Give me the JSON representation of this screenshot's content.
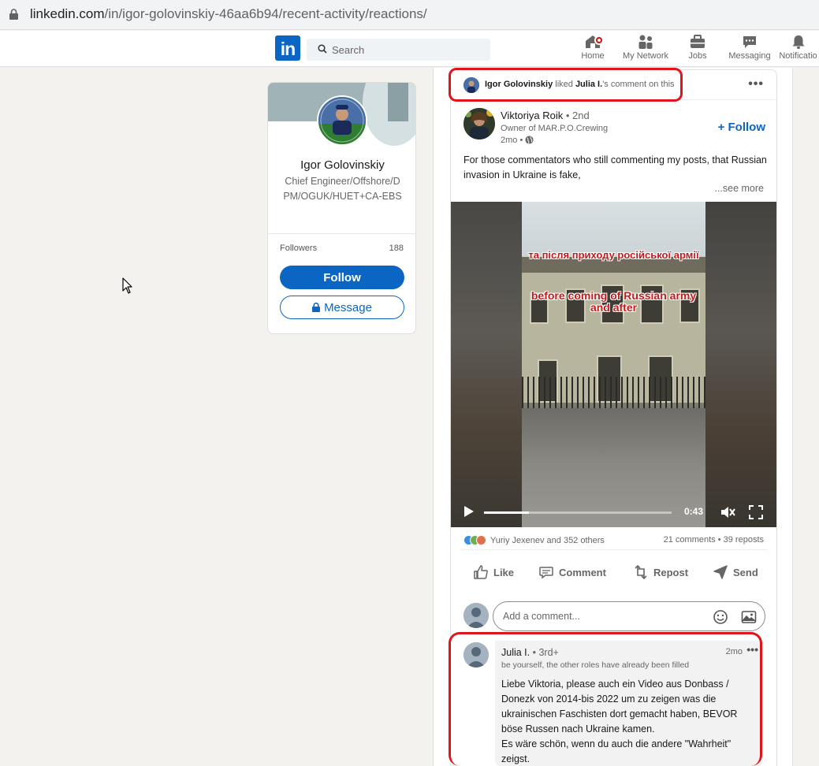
{
  "browser": {
    "url_domain": "linkedin.com",
    "url_path": "/in/igor-golovinskiy-46aa6b94/recent-activity/reactions/"
  },
  "nav": {
    "logo": "in",
    "search_placeholder": "Search",
    "items": [
      {
        "label": "Home",
        "icon": "home-icon"
      },
      {
        "label": "My Network",
        "icon": "network-icon"
      },
      {
        "label": "Jobs",
        "icon": "briefcase-icon"
      },
      {
        "label": "Messaging",
        "icon": "messaging-icon"
      },
      {
        "label": "Notificatio",
        "icon": "bell-icon"
      }
    ],
    "accent": "#0a66c2",
    "notification_color": "#cc1016"
  },
  "profile": {
    "name": "Igor Golovinskiy",
    "headline": "Chief Engineer/Offshore/DPM/OGUK/HUET+CA-EBS",
    "followers_label": "Followers",
    "followers_count": "188",
    "follow_label": "Follow",
    "message_label": "Message"
  },
  "post": {
    "activity_actor": "Igor Golovinskiy",
    "activity_verb": " liked ",
    "activity_target": "Julia I.",
    "activity_suffix": "'s comment on this",
    "author_name": "Viktoriya Roik",
    "author_degree": " • 2nd",
    "author_title": "Owner of MAR.P.O.Crewing",
    "author_time": "2mo •",
    "follow_label": "+ Follow",
    "text": "For those commentators who still commenting my posts, that Russian invasion in Ukraine is fake,",
    "see_more": "...see more",
    "video": {
      "caption_ua": "та після приходу російської армії",
      "caption_en": "before coming of Russian army and after",
      "time": "0:43",
      "progress": 0.24
    },
    "reactions_text": "Yuriy Jexenev and 352 others",
    "counts_text": "21 comments • 39 reposts",
    "actions": [
      "Like",
      "Comment",
      "Repost",
      "Send"
    ],
    "comment_placeholder": "Add a comment..."
  },
  "comment": {
    "name": "Julia I.",
    "degree": " • 3rd+",
    "time": "2mo",
    "title": "be yourself, the other roles have already been filled",
    "text_lines": [
      "Liebe Viktoria, please auch ein Video aus Donbass /",
      "Donezk von 2014-bis 2022 um zu zeigen was die",
      "ukrainischen Faschisten dort gemacht haben, BEVOR",
      "böse Russen nach Ukraine kamen.",
      "Es wäre schön, wenn du auch die andere \"Wahrheit\"",
      "zeigst."
    ]
  },
  "highlight_color": "#e0141b"
}
